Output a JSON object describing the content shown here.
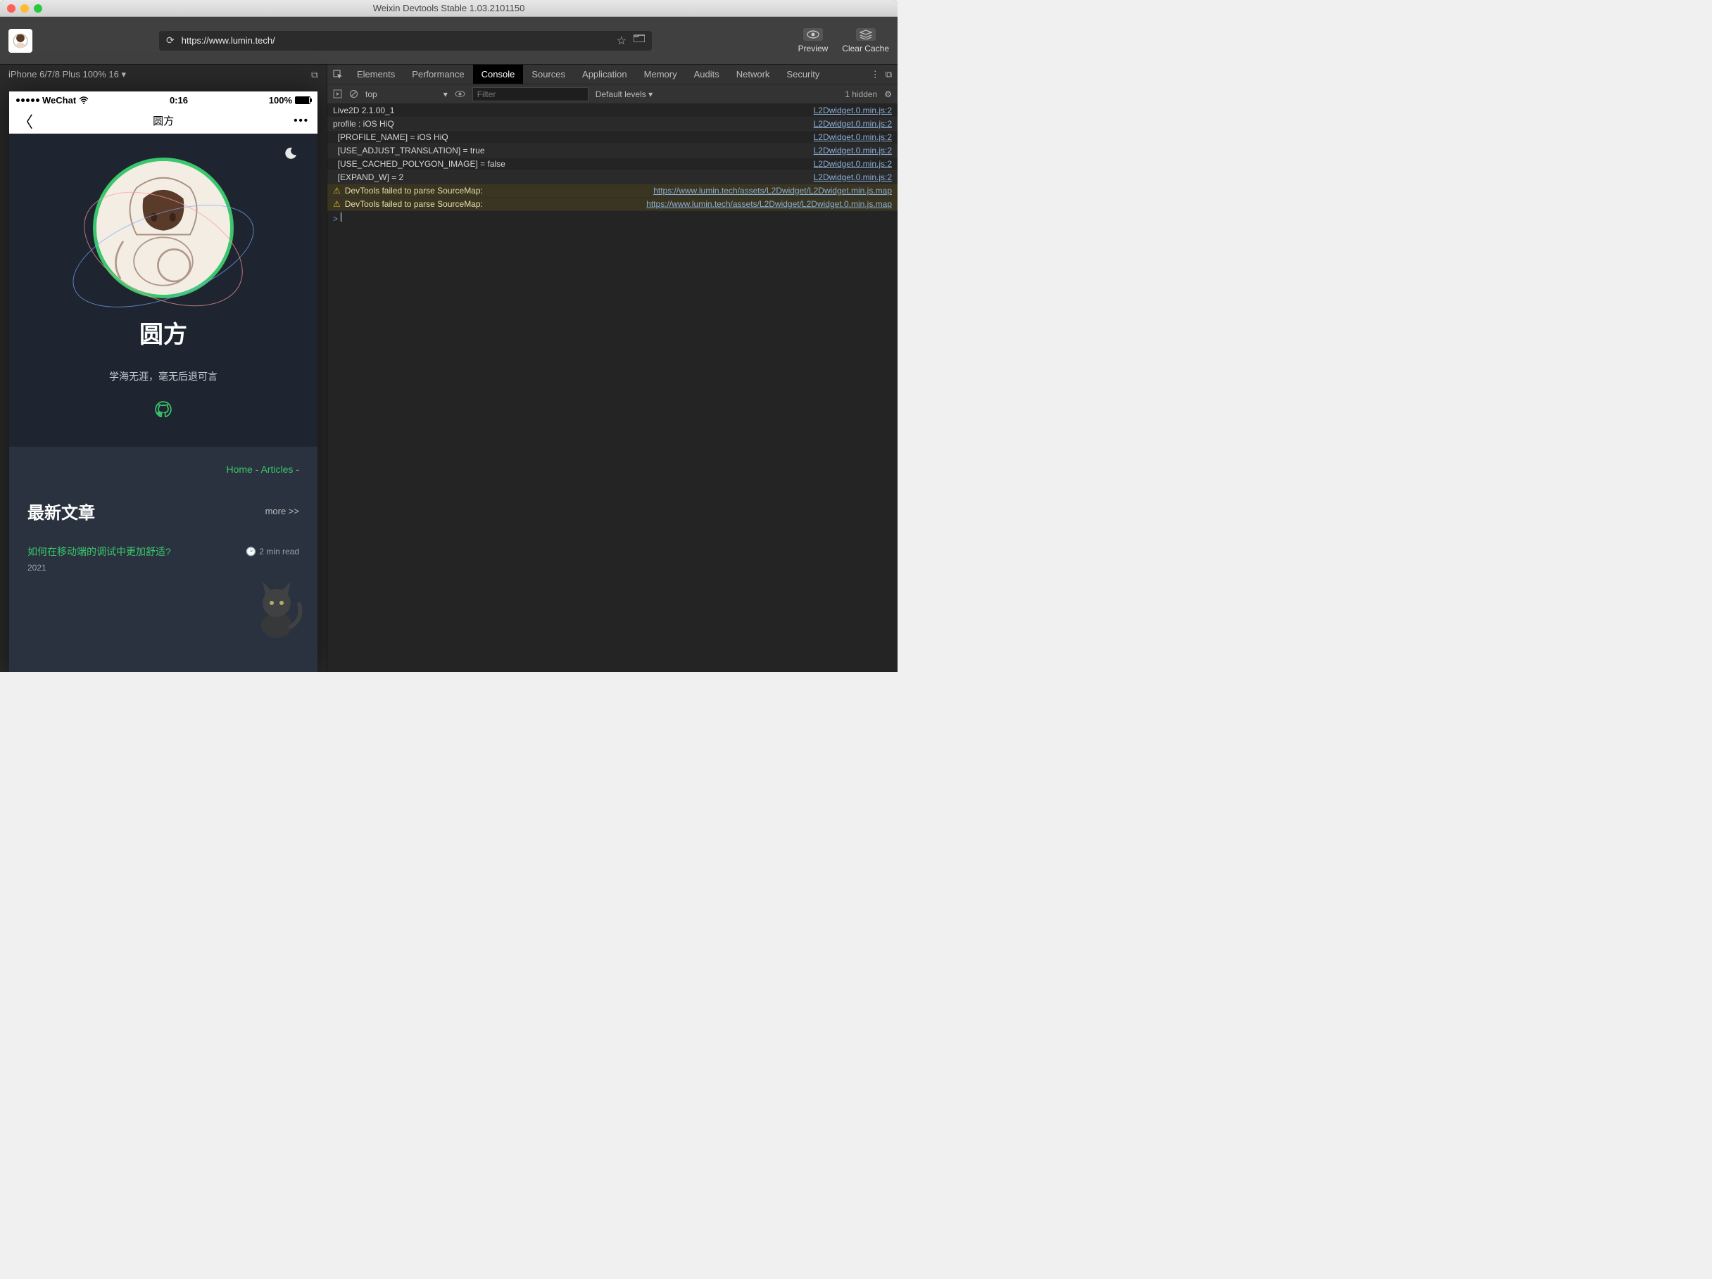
{
  "window": {
    "title": "Weixin Devtools Stable 1.03.2101150"
  },
  "toolbar": {
    "url": "https://www.lumin.tech/",
    "preview_label": "Preview",
    "clear_cache_label": "Clear Cache"
  },
  "device_bar": {
    "label": "iPhone 6/7/8 Plus 100% 16 ▾"
  },
  "phone": {
    "status": {
      "carrier": "WeChat",
      "time": "0:16",
      "battery": "100%"
    },
    "nav": {
      "title": "圆方"
    },
    "hero": {
      "name": "圆方",
      "subtitle": "学海无涯，毫无后退可言"
    },
    "breadcrumb": {
      "home": "Home",
      "articles": "Articles",
      "sep": " - "
    },
    "section": {
      "title": "最新文章",
      "more": "more >>"
    },
    "article": {
      "title": "如何在移动端的调试中更加舒适?",
      "read_time": "2 min read",
      "year": "2021"
    }
  },
  "devtools": {
    "tabs": [
      "Elements",
      "Performance",
      "Console",
      "Sources",
      "Application",
      "Memory",
      "Audits",
      "Network",
      "Security"
    ],
    "active_tab": "Console",
    "subbar": {
      "context": "top",
      "filter_placeholder": "Filter",
      "levels": "Default levels ▾",
      "hidden": "1 hidden"
    },
    "logs": [
      {
        "type": "log",
        "indent": 0,
        "msg": "Live2D 2.1.00_1",
        "src": "L2Dwidget.0.min.js:2"
      },
      {
        "type": "log",
        "indent": 0,
        "msg": "profile : iOS HiQ",
        "src": "L2Dwidget.0.min.js:2"
      },
      {
        "type": "log",
        "indent": 1,
        "msg": "[PROFILE_NAME] = iOS HiQ",
        "src": "L2Dwidget.0.min.js:2"
      },
      {
        "type": "log",
        "indent": 1,
        "msg": "[USE_ADJUST_TRANSLATION] = true",
        "src": "L2Dwidget.0.min.js:2"
      },
      {
        "type": "log",
        "indent": 1,
        "msg": "[USE_CACHED_POLYGON_IMAGE] = false",
        "src": "L2Dwidget.0.min.js:2"
      },
      {
        "type": "log",
        "indent": 1,
        "msg": "[EXPAND_W] = 2",
        "src": "L2Dwidget.0.min.js:2"
      },
      {
        "type": "warn",
        "indent": 0,
        "msg": "DevTools failed to parse SourceMap: ",
        "link": "https://www.lumin.tech/assets/L2Dwidget/L2Dwidget.min.js.map"
      },
      {
        "type": "warn",
        "indent": 0,
        "msg": "DevTools failed to parse SourceMap: ",
        "link": "https://www.lumin.tech/assets/L2Dwidget/L2Dwidget.0.min.js.map"
      }
    ]
  }
}
